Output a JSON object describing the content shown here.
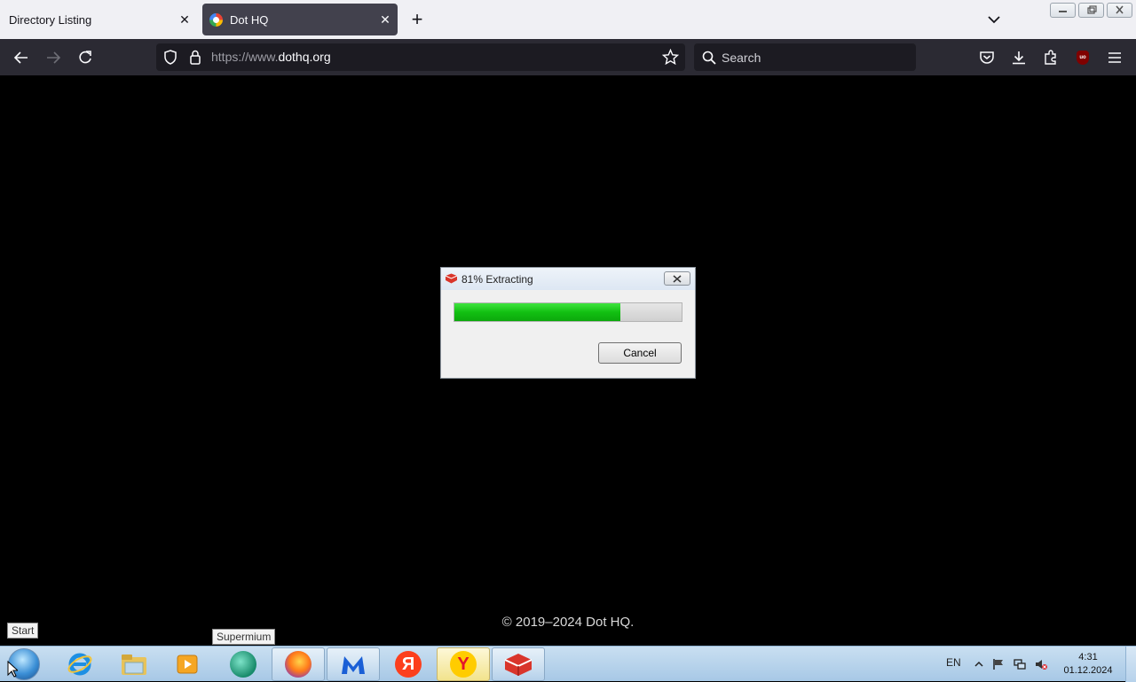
{
  "browser": {
    "tabs": [
      {
        "title": "Directory Listing",
        "active": false
      },
      {
        "title": "Dot HQ",
        "active": true
      }
    ],
    "url": {
      "scheme": "https://www.",
      "host": "dothq.org"
    },
    "search_placeholder": "Search",
    "extension_badge": "uo"
  },
  "page": {
    "footer": "© 2019–2024 Dot HQ."
  },
  "dialog": {
    "title": "81% Extracting",
    "progress": 0.73,
    "cancel_label": "Cancel"
  },
  "tooltips": {
    "start": "Start",
    "supermium": "Supermium"
  },
  "taskbar": {
    "apps": [
      "Internet Explorer",
      "Windows Explorer",
      "Media Player",
      "Supermium",
      "Firefox",
      "Malwarebytes",
      "Yandex",
      "Yandex Browser",
      "Archiver"
    ],
    "tray_language": "EN",
    "clock_time": "4:31",
    "clock_date": "01.12.2024"
  },
  "colors": {
    "toolbar": "#2b2a33",
    "progress_green": "#12c012",
    "ublock_red": "#800000"
  }
}
